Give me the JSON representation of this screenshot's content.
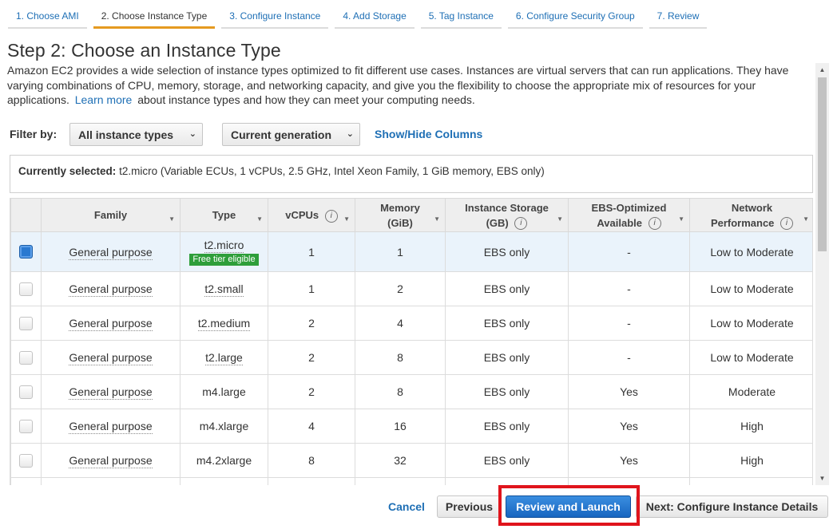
{
  "wizard": {
    "tabs": [
      {
        "label": "1. Choose AMI"
      },
      {
        "label": "2. Choose Instance Type"
      },
      {
        "label": "3. Configure Instance"
      },
      {
        "label": "4. Add Storage"
      },
      {
        "label": "5. Tag Instance"
      },
      {
        "label": "6. Configure Security Group"
      },
      {
        "label": "7. Review"
      }
    ],
    "active_index": 1
  },
  "page": {
    "title": "Step 2: Choose an Instance Type",
    "description_before": "Amazon EC2 provides a wide selection of instance types optimized to fit different use cases. Instances are virtual servers that can run applications. They have varying combinations of CPU, memory, storage, and networking capacity, and give you the flexibility to choose the appropriate mix of resources for your applications.",
    "learn_more": "Learn more",
    "description_after": "about instance types and how they can meet your computing needs."
  },
  "filter": {
    "label": "Filter by:",
    "instance_types_value": "All instance types",
    "generation_value": "Current generation",
    "show_hide": "Show/Hide Columns"
  },
  "current_selection": {
    "label": "Currently selected:",
    "value": "t2.micro (Variable ECUs, 1 vCPUs, 2.5 GHz, Intel Xeon Family, 1 GiB memory, EBS only)"
  },
  "table": {
    "headers": {
      "family": "Family",
      "type": "Type",
      "vcpus": "vCPUs",
      "memory_1": "Memory",
      "memory_2": "(GiB)",
      "storage_1": "Instance Storage",
      "storage_2": "(GB)",
      "ebs_1": "EBS-Optimized",
      "ebs_2": "Available",
      "network_1": "Network",
      "network_2": "Performance"
    },
    "info_glyph": "i",
    "rows": [
      {
        "family": "General purpose",
        "type": "t2.micro",
        "badge": "Free tier eligible",
        "vcpus": "1",
        "memory": "1",
        "storage": "EBS only",
        "ebs": "-",
        "network": "Low to Moderate",
        "selected": true
      },
      {
        "family": "General purpose",
        "type": "t2.small",
        "badge": "",
        "vcpus": "1",
        "memory": "2",
        "storage": "EBS only",
        "ebs": "-",
        "network": "Low to Moderate",
        "selected": false
      },
      {
        "family": "General purpose",
        "type": "t2.medium",
        "badge": "",
        "vcpus": "2",
        "memory": "4",
        "storage": "EBS only",
        "ebs": "-",
        "network": "Low to Moderate",
        "selected": false
      },
      {
        "family": "General purpose",
        "type": "t2.large",
        "badge": "",
        "vcpus": "2",
        "memory": "8",
        "storage": "EBS only",
        "ebs": "-",
        "network": "Low to Moderate",
        "selected": false
      },
      {
        "family": "General purpose",
        "type": "m4.large",
        "badge": "",
        "vcpus": "2",
        "memory": "8",
        "storage": "EBS only",
        "ebs": "Yes",
        "network": "Moderate",
        "selected": false
      },
      {
        "family": "General purpose",
        "type": "m4.xlarge",
        "badge": "",
        "vcpus": "4",
        "memory": "16",
        "storage": "EBS only",
        "ebs": "Yes",
        "network": "High",
        "selected": false
      },
      {
        "family": "General purpose",
        "type": "m4.2xlarge",
        "badge": "",
        "vcpus": "8",
        "memory": "32",
        "storage": "EBS only",
        "ebs": "Yes",
        "network": "High",
        "selected": false
      }
    ]
  },
  "footer": {
    "cancel": "Cancel",
    "previous": "Previous",
    "review_launch": "Review and Launch",
    "next": "Next: Configure Instance Details"
  },
  "colors": {
    "link": "#1e6fb5",
    "active_tab_underline": "#e59a20",
    "primary_button": "#1866c0",
    "free_tier_badge": "#2e9e3a",
    "highlight_box": "#e0141c",
    "selected_row": "#eaf3fb"
  },
  "icons": {
    "dropdown": "chevron-down-icon",
    "sort": "sort-caret-icon",
    "info": "info-icon",
    "scroll_up": "scroll-up-arrow-icon",
    "scroll_down": "scroll-down-arrow-icon"
  }
}
